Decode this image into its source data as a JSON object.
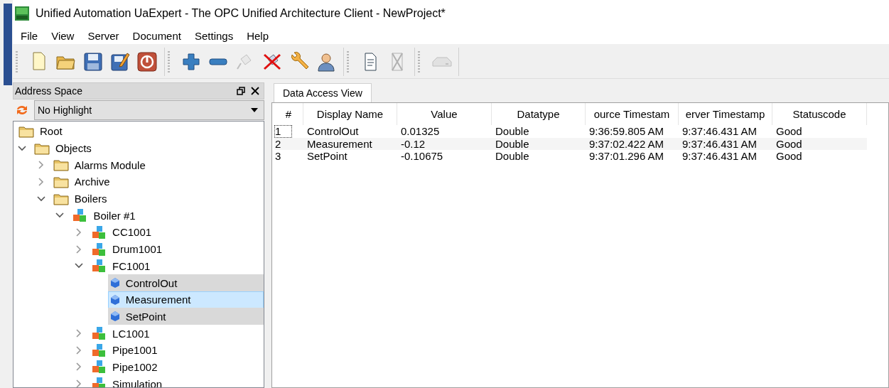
{
  "window": {
    "title": "Unified Automation UaExpert - The OPC Unified Architecture Client - NewProject*"
  },
  "menu": [
    "File",
    "View",
    "Server",
    "Document",
    "Settings",
    "Help"
  ],
  "toolbar": [
    {
      "buttons": [
        {
          "kind": "new",
          "disabled": false
        },
        {
          "kind": "open",
          "disabled": false
        },
        {
          "kind": "save",
          "disabled": false
        },
        {
          "kind": "saveas",
          "disabled": false
        },
        {
          "kind": "power",
          "disabled": false
        }
      ]
    },
    {
      "buttons": [
        {
          "kind": "add",
          "disabled": false
        },
        {
          "kind": "remove",
          "disabled": false
        },
        {
          "kind": "connect",
          "disabled": true
        },
        {
          "kind": "disconnect",
          "disabled": false
        },
        {
          "kind": "wrench",
          "disabled": false
        },
        {
          "kind": "user",
          "disabled": false
        }
      ]
    },
    {
      "buttons": [
        {
          "kind": "document",
          "disabled": false
        },
        {
          "kind": "deletedoc",
          "disabled": true
        }
      ]
    },
    {
      "buttons": [
        {
          "kind": "drive",
          "disabled": true
        }
      ]
    }
  ],
  "address_space": {
    "title": "Address Space",
    "highlight": {
      "value": "No Highlight"
    },
    "tree": [
      {
        "label": "Root",
        "kind": "folder",
        "selected": false,
        "focused": false,
        "children": [
          {
            "label": "Objects",
            "kind": "folder",
            "expanded": true,
            "selected": false,
            "focused": false,
            "children": [
              {
                "label": "Alarms Module",
                "kind": "folder",
                "expanded": false,
                "selected": false,
                "focused": false
              },
              {
                "label": "Archive",
                "kind": "folder",
                "expanded": false,
                "selected": false,
                "focused": false
              },
              {
                "label": "Boilers",
                "kind": "folder",
                "expanded": true,
                "selected": false,
                "focused": false,
                "children": [
                  {
                    "label": "Boiler #1",
                    "kind": "object",
                    "expanded": true,
                    "selected": false,
                    "focused": false,
                    "children": [
                      {
                        "label": "CC1001",
                        "kind": "object",
                        "expanded": false,
                        "selected": false,
                        "focused": false
                      },
                      {
                        "label": "Drum1001",
                        "kind": "object",
                        "expanded": false,
                        "selected": false,
                        "focused": false
                      },
                      {
                        "label": "FC1001",
                        "kind": "object",
                        "expanded": true,
                        "selected": false,
                        "focused": false,
                        "children": [
                          {
                            "label": "ControlOut",
                            "kind": "variable",
                            "selected": true,
                            "focused": false
                          },
                          {
                            "label": "Measurement",
                            "kind": "variable",
                            "selected": true,
                            "focused": true
                          },
                          {
                            "label": "SetPoint",
                            "kind": "variable",
                            "selected": true,
                            "focused": false
                          }
                        ]
                      },
                      {
                        "label": "LC1001",
                        "kind": "object",
                        "expanded": false,
                        "selected": false,
                        "focused": false
                      },
                      {
                        "label": "Pipe1001",
                        "kind": "object",
                        "expanded": false,
                        "selected": false,
                        "focused": false
                      },
                      {
                        "label": "Pipe1002",
                        "kind": "object",
                        "expanded": false,
                        "selected": false,
                        "focused": false
                      },
                      {
                        "label": "Simulation",
                        "kind": "object",
                        "expanded": false,
                        "selected": false,
                        "focused": false
                      }
                    ]
                  }
                ]
              }
            ]
          }
        ]
      }
    ]
  },
  "tabs": [
    {
      "label": "Data Access View",
      "selected": true
    }
  ],
  "table": {
    "columns": [
      "#",
      "Display Name",
      "Value",
      "Datatype",
      "ource Timestam",
      "erver Timestamp",
      "Statuscode"
    ],
    "rows": [
      {
        "focused": true,
        "cells": [
          "1",
          "ControlOut",
          "0.01325",
          "Double",
          "9:36:59.805 AM",
          "9:37:46.431 AM",
          "Good"
        ]
      },
      {
        "focused": false,
        "cells": [
          "2",
          "Measurement",
          "-0.12",
          "Double",
          "9:37:02.422 AM",
          "9:37:46.431 AM",
          "Good"
        ]
      },
      {
        "focused": false,
        "cells": [
          "3",
          "SetPoint",
          "-0.10675",
          "Double",
          "9:37:01.296 AM",
          "9:37:46.431 AM",
          "Good"
        ]
      }
    ]
  }
}
